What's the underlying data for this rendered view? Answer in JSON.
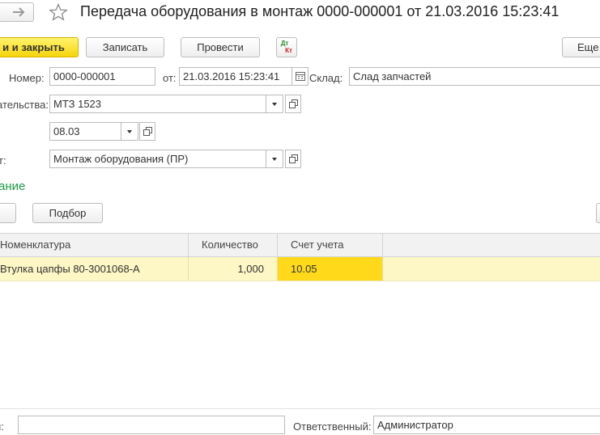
{
  "window": {
    "title": "Передача оборудования в монтаж 0000-000001 от 21.03.2016 15:23:41",
    "nav_forward_icon": "arrow-right-icon",
    "favorite_icon": "star-icon"
  },
  "toolbar": {
    "post_close_label": "и и закрыть",
    "save_label": "Записать",
    "post_label": "Провести",
    "dtkt_icon_text": {
      "top": "Дт",
      "bottom": "Кт"
    },
    "more_label": "Еще"
  },
  "form": {
    "number_label": "Номер:",
    "number_value": "0000-000001",
    "date_label": "от:",
    "date_value": "21.03.2016 15:23:41",
    "warehouse_label": "Склад:",
    "warehouse_value": "Слад запчастей",
    "vehicle_label": "ательства:",
    "vehicle_value": "МТЗ 1523",
    "period_value": "08.03",
    "operation_label": "т:",
    "operation_value": "Монтаж оборудования (ПР)"
  },
  "section": {
    "title": "ание",
    "pick_label": "Подбор"
  },
  "table": {
    "columns": [
      "Номенклатура",
      "Количество",
      "Счет учета"
    ],
    "rows": [
      {
        "item": "Втулка цапфы 80-3001068-А",
        "quantity": "1,000",
        "account": "10.05"
      }
    ]
  },
  "footer": {
    "comment_label": "й:",
    "comment_value": "",
    "responsible_label": "Ответственный:",
    "responsible_value": "Администратор"
  },
  "colors": {
    "primary_button": "#f6d40b",
    "section_title": "#1f9a47",
    "selected_row": "#fdf6c5",
    "selected_cell": "#ffd91a"
  }
}
